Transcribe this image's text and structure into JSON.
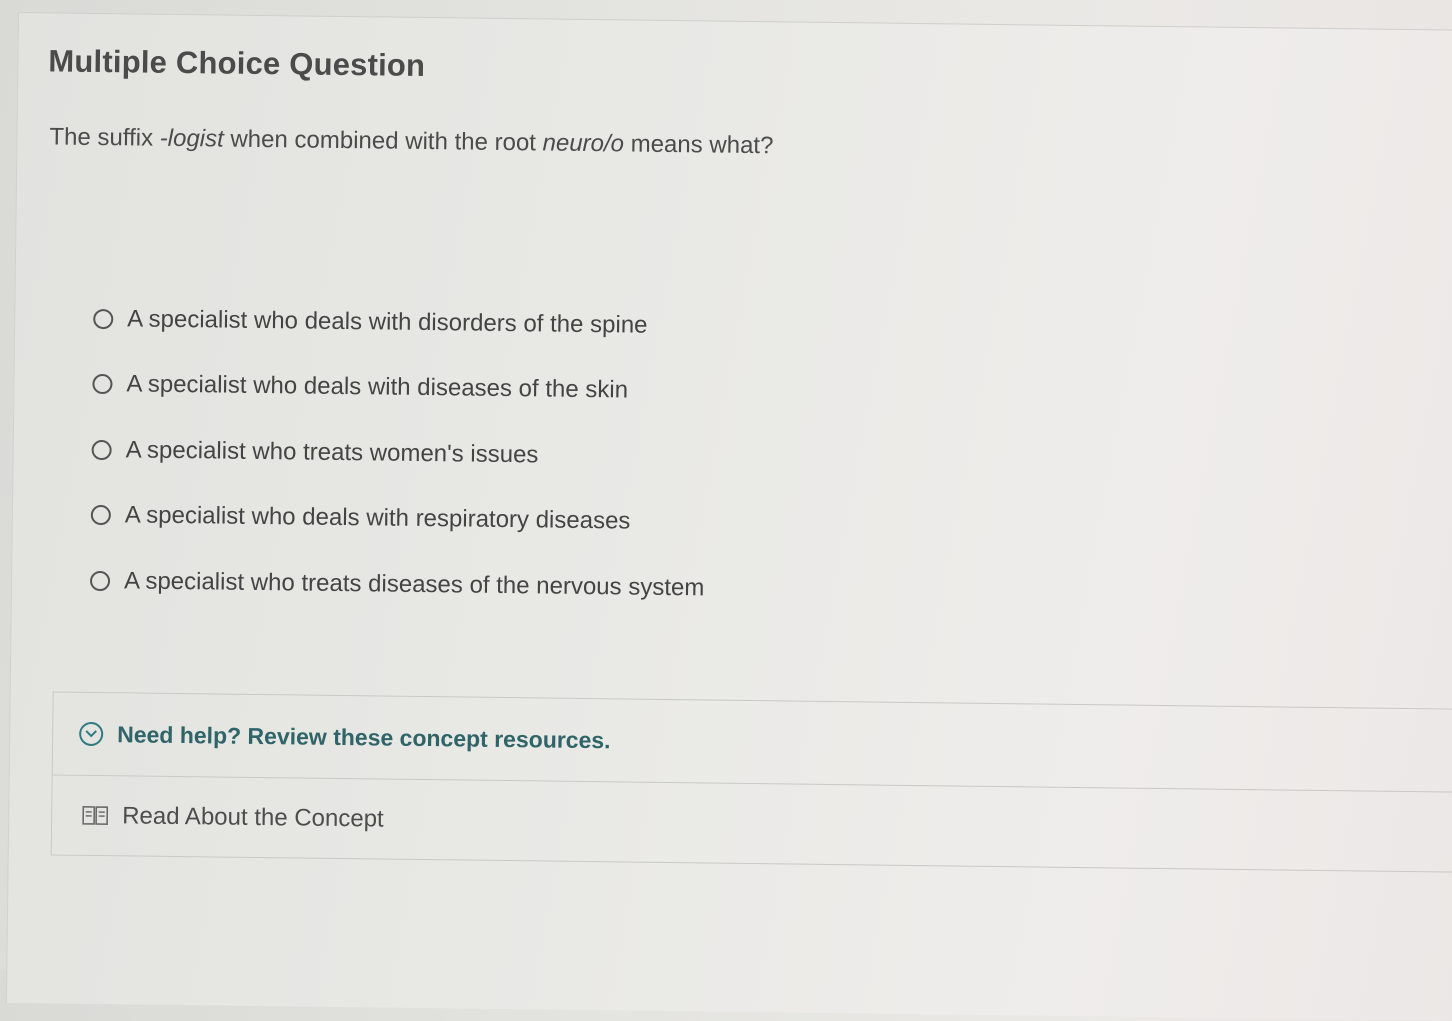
{
  "question": {
    "type_label": "Multiple Choice Question",
    "prompt": {
      "prefix": "The suffix ",
      "suffix_term": "-logist",
      "middle": " when combined with the root ",
      "root_term": "neuro/o",
      "end": " means what?"
    },
    "options": [
      "A specialist who deals with disorders of the spine",
      "A specialist who deals with diseases of the skin",
      "A specialist who treats women's issues",
      "A specialist who deals with respiratory diseases",
      "A specialist who treats diseases of the nervous system"
    ]
  },
  "resources": {
    "help_label": "Need help? Review these concept resources.",
    "read_label": "Read About the Concept"
  },
  "colors": {
    "accent_teal": "#2f6468"
  }
}
